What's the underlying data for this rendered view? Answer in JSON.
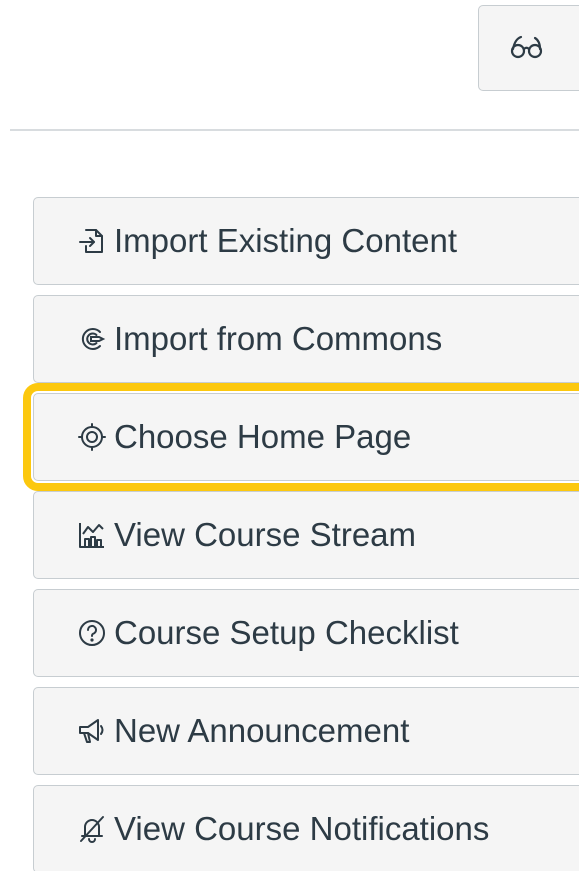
{
  "header": {
    "view_toggle_icon": "glasses-icon"
  },
  "actions": [
    {
      "label": "Import Existing Content",
      "icon": "import-icon"
    },
    {
      "label": "Import from Commons",
      "icon": "commons-icon"
    },
    {
      "label": "Choose Home Page",
      "icon": "target-icon",
      "focused": true
    },
    {
      "label": "View Course Stream",
      "icon": "stream-icon"
    },
    {
      "label": "Course Setup Checklist",
      "icon": "question-circle-icon"
    },
    {
      "label": "New Announcement",
      "icon": "megaphone-icon"
    },
    {
      "label": "View Course Notifications",
      "icon": "bell-off-icon"
    }
  ],
  "colors": {
    "focus_outline": "#fcc80e",
    "button_bg": "#f5f5f5",
    "button_border": "#c7cdd1",
    "text": "#2d3b45"
  }
}
